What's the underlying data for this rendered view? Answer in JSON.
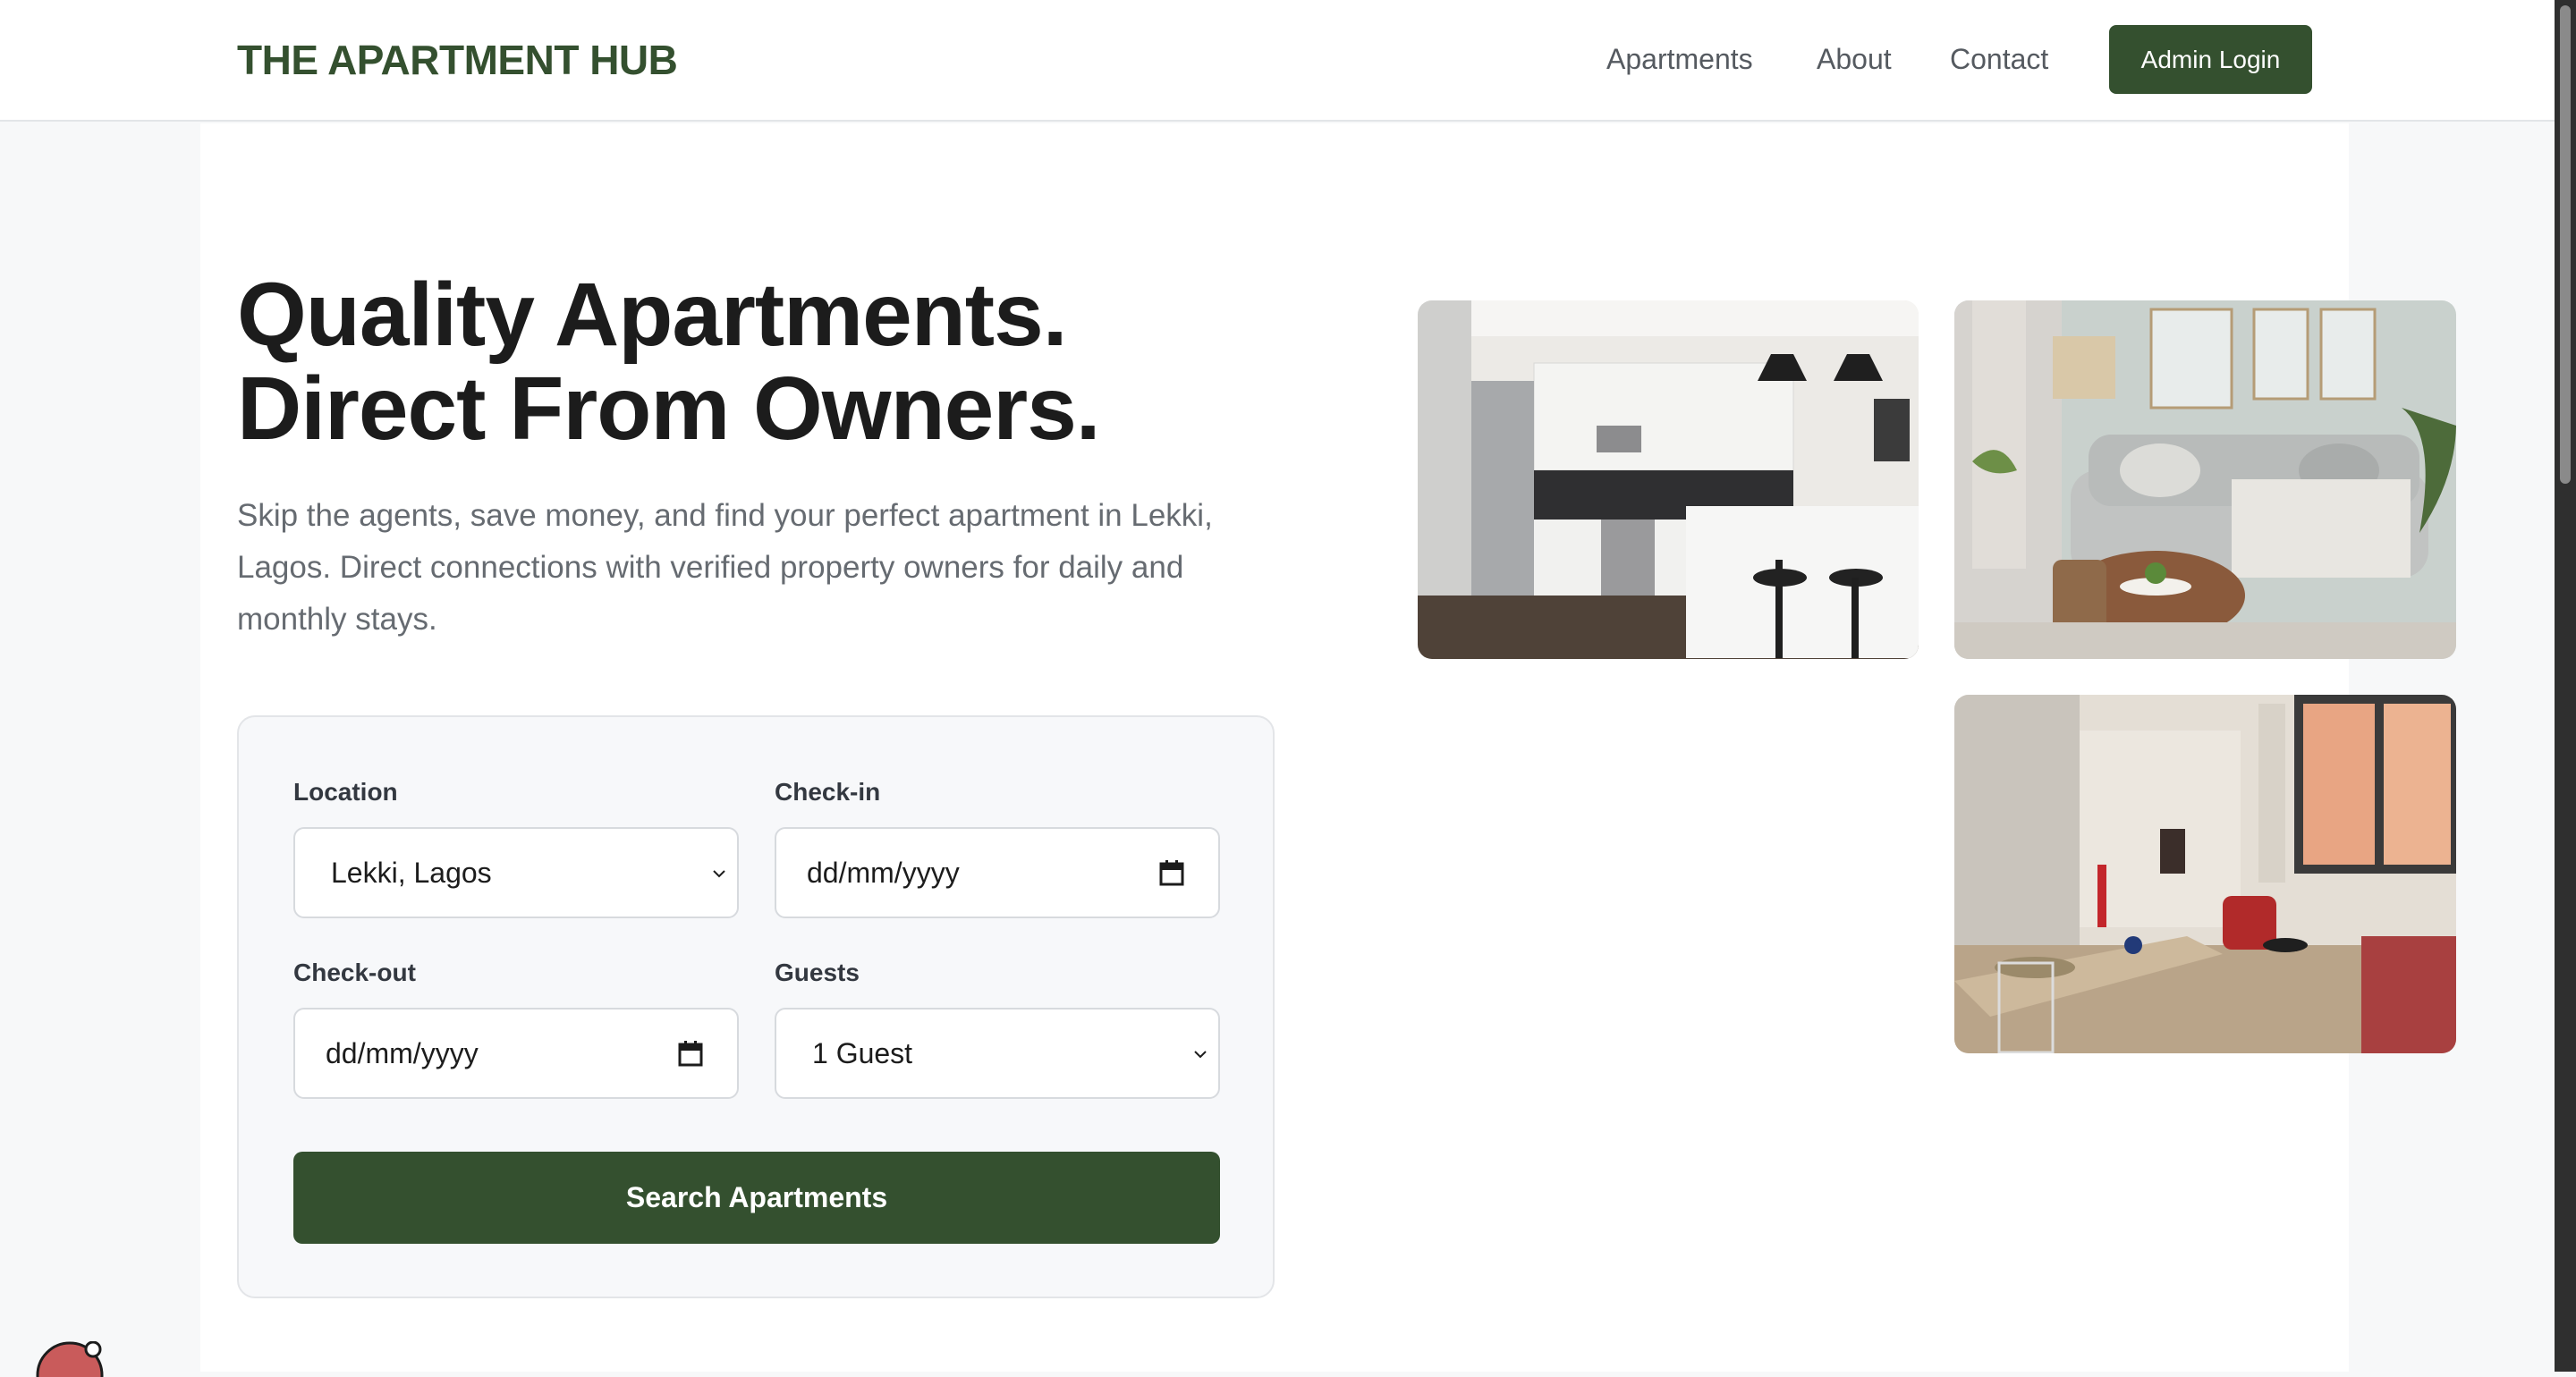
{
  "header": {
    "brand": "THE APARTMENT HUB",
    "nav": [
      "Apartments",
      "About",
      "Contact"
    ],
    "admin_button": "Admin Login"
  },
  "hero": {
    "headline_line1": "Quality Apartments.",
    "headline_line2": "Direct From Owners.",
    "subtitle": "Skip the agents, save money, and find your perfect apartment in Lekki, Lagos. Direct connections with verified property owners for daily and monthly stays."
  },
  "search": {
    "location_label": "Location",
    "location_value": "Lekki, Lagos",
    "checkin_label": "Check-in",
    "checkin_placeholder": "dd/mm/yyyy",
    "checkout_label": "Check-out",
    "checkout_placeholder": "dd/mm/yyyy",
    "guests_label": "Guests",
    "guests_value": "1 Guest",
    "button": "Search Apartments"
  },
  "colors": {
    "brand_green": "#34502f",
    "text_dark": "#1c1c1c",
    "text_muted": "#666b71"
  }
}
